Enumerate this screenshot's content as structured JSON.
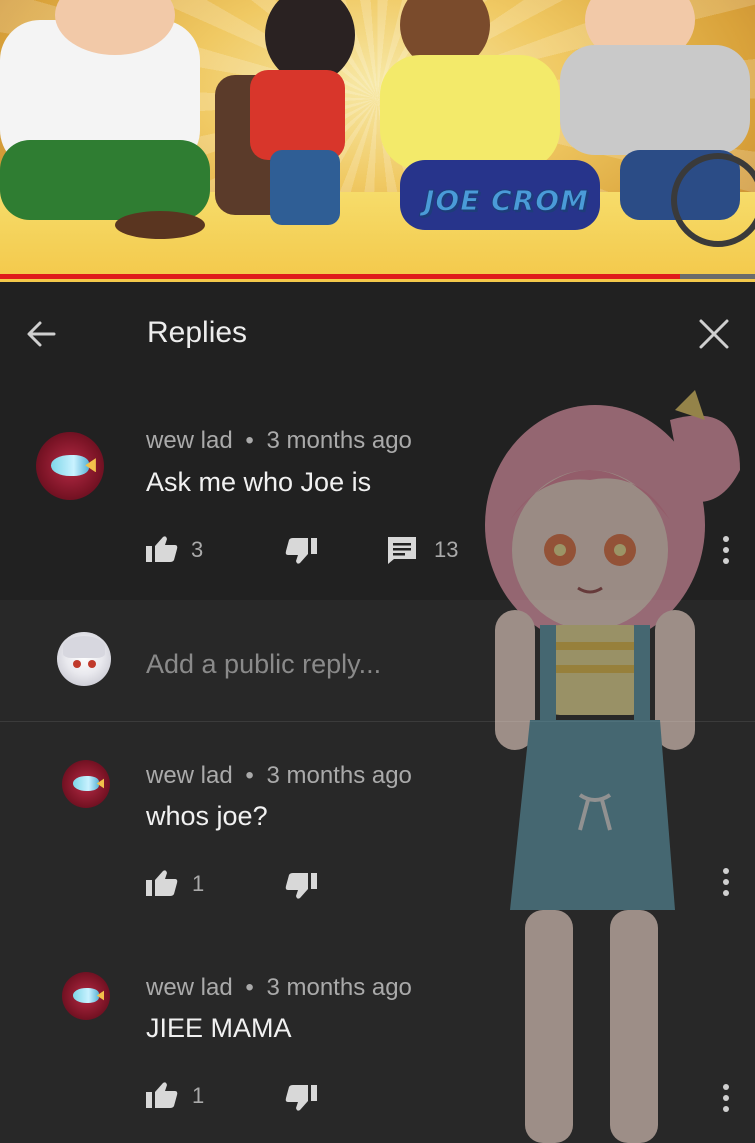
{
  "video": {
    "watermark_text": "JOE CROM",
    "progress_fraction": 0.9,
    "progress_color": "#e0191b"
  },
  "header": {
    "title": "Replies",
    "back_icon": "arrow-left-icon",
    "close_icon": "close-icon"
  },
  "original_comment": {
    "author": "wew lad",
    "separator": "•",
    "time": "3 months ago",
    "text": "Ask me who Joe is",
    "likes": "3",
    "replies": "13"
  },
  "reply_box": {
    "placeholder": "Add a public reply..."
  },
  "replies": [
    {
      "author": "wew lad",
      "separator": "•",
      "time": "3 months ago",
      "text": "whos joe?",
      "likes": "1"
    },
    {
      "author": "wew lad",
      "separator": "•",
      "time": "3 months ago",
      "text": "JIEE MAMA",
      "likes": "1"
    }
  ],
  "colors": {
    "background": "#282828",
    "header_bg": "#212121",
    "text_primary": "#f1f1f1",
    "text_secondary": "#aaaaaa"
  }
}
